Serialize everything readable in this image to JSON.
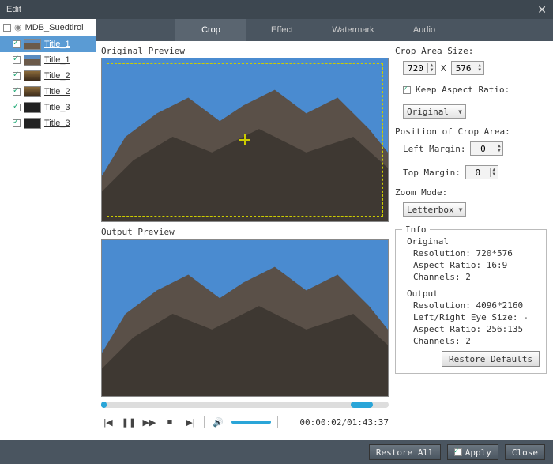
{
  "window": {
    "title": "Edit"
  },
  "sidebar": {
    "root": "MDB_Suedtirol",
    "items": [
      {
        "label": "Title_1",
        "thumb": "mountain",
        "selected": true
      },
      {
        "label": "Title_1",
        "thumb": "mountain",
        "selected": false
      },
      {
        "label": "Title_2",
        "thumb": "brown",
        "selected": false
      },
      {
        "label": "Title_2",
        "thumb": "brown",
        "selected": false
      },
      {
        "label": "Title_3",
        "thumb": "dark",
        "selected": false
      },
      {
        "label": "Title_3",
        "thumb": "dark",
        "selected": false
      }
    ]
  },
  "tabs": [
    "Crop",
    "Effect",
    "Watermark",
    "Audio"
  ],
  "active_tab": 0,
  "preview": {
    "orig_label": "Original Preview",
    "out_label": "Output Preview"
  },
  "playback": {
    "time": "00:00:02/01:43:37"
  },
  "crop": {
    "size_label": "Crop Area Size:",
    "width": "720",
    "height": "576",
    "x_sep": "X",
    "keep_ratio_label": "Keep Aspect Ratio:",
    "keep_ratio_checked": true,
    "ratio_select": "Original",
    "pos_label": "Position of Crop Area:",
    "left_label": "Left Margin:",
    "left_value": "0",
    "top_label": "Top Margin:",
    "top_value": "0",
    "zoom_label": "Zoom Mode:",
    "zoom_select": "Letterbox"
  },
  "info": {
    "legend": "Info",
    "orig_h": "Original",
    "orig_res": "Resolution: 720*576",
    "orig_ar": "Aspect Ratio: 16:9",
    "orig_ch": "Channels: 2",
    "out_h": "Output",
    "out_res": "Resolution: 4096*2160",
    "out_eye": "Left/Right Eye Size: -",
    "out_ar": "Aspect Ratio: 256:135",
    "out_ch": "Channels: 2",
    "restore": "Restore Defaults"
  },
  "footer": {
    "restore_all": "Restore All",
    "apply": "Apply",
    "close": "Close"
  }
}
